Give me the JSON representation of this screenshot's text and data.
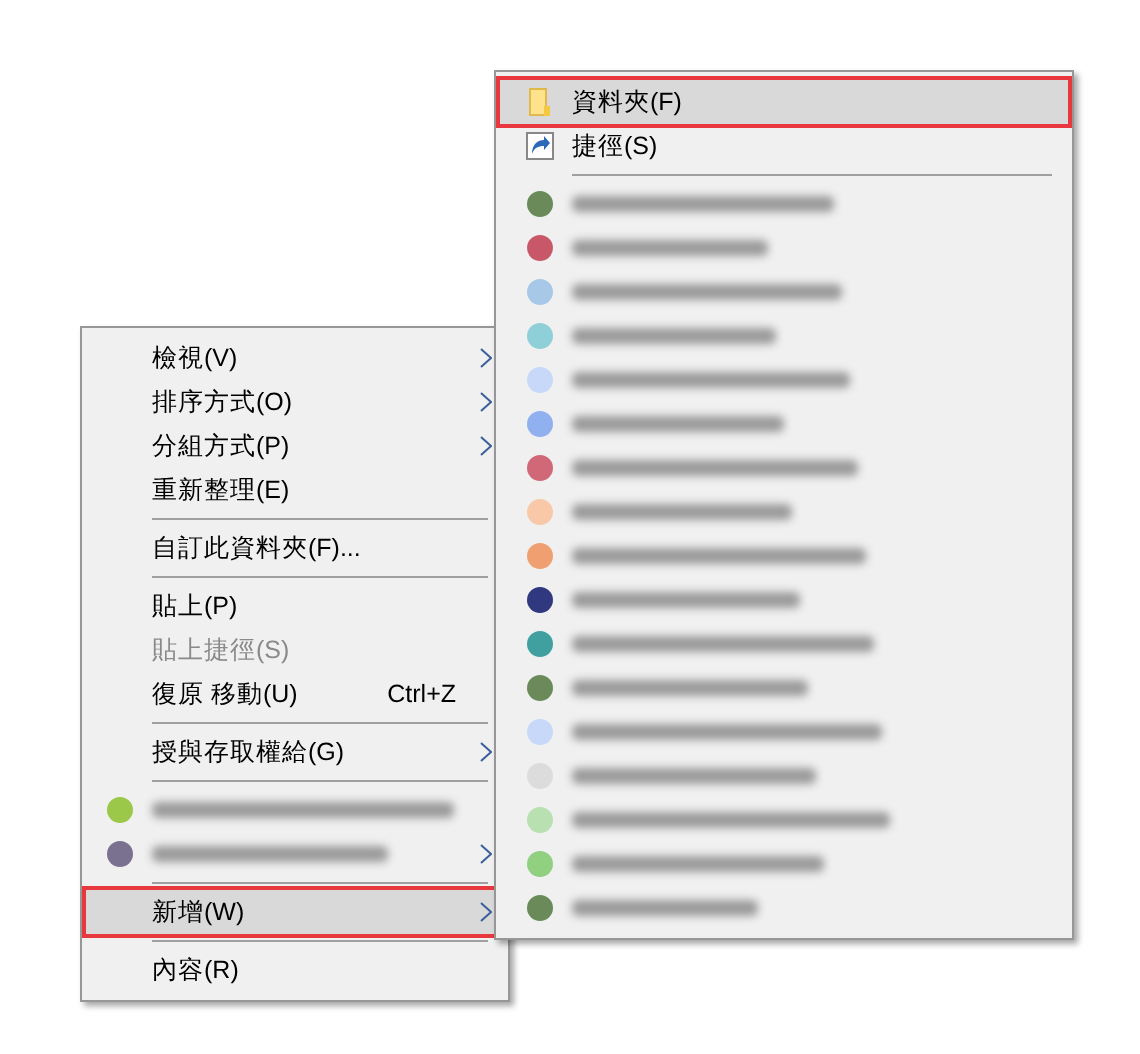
{
  "context_menu": {
    "items": [
      {
        "kind": "item",
        "label": "檢視(V)",
        "submenu": true,
        "disabled": false,
        "selected": false,
        "outlined": false
      },
      {
        "kind": "item",
        "label": "排序方式(O)",
        "submenu": true,
        "disabled": false,
        "selected": false,
        "outlined": false
      },
      {
        "kind": "item",
        "label": "分組方式(P)",
        "submenu": true,
        "disabled": false,
        "selected": false,
        "outlined": false
      },
      {
        "kind": "item",
        "label": "重新整理(E)",
        "submenu": false,
        "disabled": false,
        "selected": false,
        "outlined": false
      },
      {
        "kind": "separator"
      },
      {
        "kind": "item",
        "label": "自訂此資料夾(F)...",
        "submenu": false,
        "disabled": false,
        "selected": false,
        "outlined": false
      },
      {
        "kind": "separator"
      },
      {
        "kind": "item",
        "label": "貼上(P)",
        "submenu": false,
        "disabled": false,
        "selected": false,
        "outlined": false
      },
      {
        "kind": "item",
        "label": "貼上捷徑(S)",
        "submenu": false,
        "disabled": true,
        "selected": false,
        "outlined": false
      },
      {
        "kind": "item",
        "label": "復原 移動(U)",
        "shortcut": "Ctrl+Z",
        "submenu": false,
        "disabled": false,
        "selected": false,
        "outlined": false
      },
      {
        "kind": "separator"
      },
      {
        "kind": "item",
        "label": "授與存取權給(G)",
        "submenu": true,
        "disabled": false,
        "selected": false,
        "outlined": false
      },
      {
        "kind": "separator"
      },
      {
        "kind": "blurred",
        "color": "#9cc84a",
        "submenu": false
      },
      {
        "kind": "blurred",
        "color": "#7a7090",
        "submenu": true
      },
      {
        "kind": "separator"
      },
      {
        "kind": "item",
        "label": "新增(W)",
        "submenu": true,
        "disabled": false,
        "selected": true,
        "outlined": true
      },
      {
        "kind": "separator"
      },
      {
        "kind": "item",
        "label": "內容(R)",
        "submenu": false,
        "disabled": false,
        "selected": false,
        "outlined": false
      }
    ]
  },
  "new_submenu": {
    "items": [
      {
        "kind": "folder",
        "label": "資料夾(F)",
        "submenu": false,
        "disabled": false,
        "selected": true,
        "outlined": true
      },
      {
        "kind": "shortcut",
        "label": "捷徑(S)",
        "submenu": false,
        "disabled": false,
        "selected": false,
        "outlined": false
      },
      {
        "kind": "separator"
      },
      {
        "kind": "blurred",
        "color": "#6a8a5a"
      },
      {
        "kind": "blurred",
        "color": "#c85868"
      },
      {
        "kind": "blurred",
        "color": "#a8c8e8"
      },
      {
        "kind": "blurred",
        "color": "#8fd0d8"
      },
      {
        "kind": "blurred",
        "color": "#c8d8f8"
      },
      {
        "kind": "blurred",
        "color": "#90b0f0"
      },
      {
        "kind": "blurred",
        "color": "#d06878"
      },
      {
        "kind": "blurred",
        "color": "#f8c8a8"
      },
      {
        "kind": "blurred",
        "color": "#f0a070"
      },
      {
        "kind": "blurred",
        "color": "#303880"
      },
      {
        "kind": "blurred",
        "color": "#40a0a0"
      },
      {
        "kind": "blurred",
        "color": "#6a8a5a"
      },
      {
        "kind": "blurred",
        "color": "#c8d8f8"
      },
      {
        "kind": "blurred",
        "color": "#dcdcdc"
      },
      {
        "kind": "blurred",
        "color": "#b8e0b0"
      },
      {
        "kind": "blurred",
        "color": "#90d080"
      },
      {
        "kind": "blurred",
        "color": "#6a8a5a"
      }
    ]
  }
}
